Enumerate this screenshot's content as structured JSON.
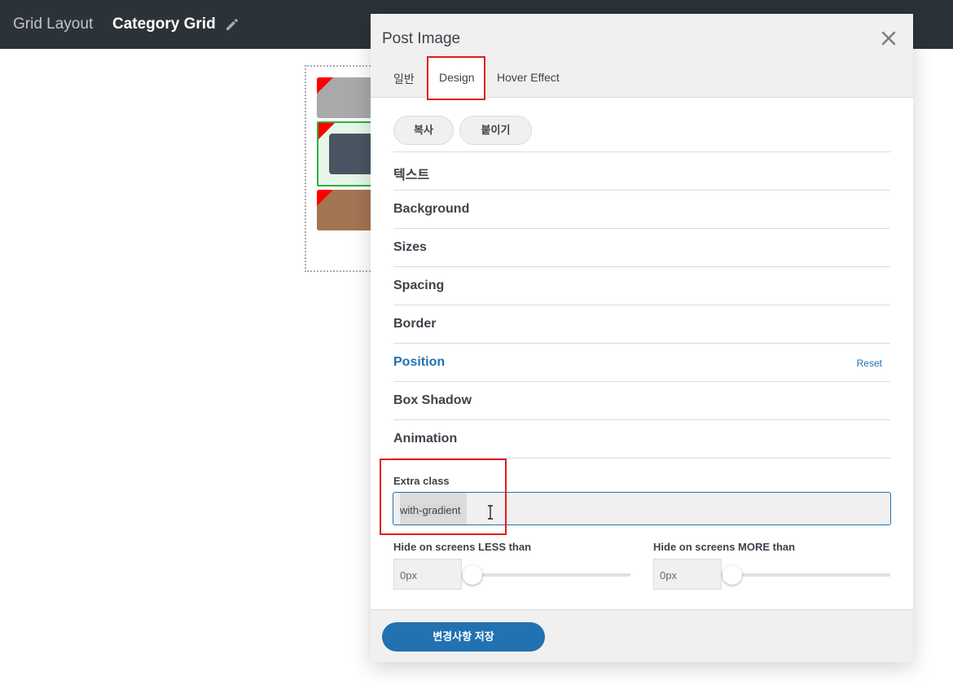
{
  "topbar": {
    "breadcrumb": "Grid Layout",
    "title": "Category Grid",
    "edit_icon": "pencil-icon"
  },
  "modal": {
    "title": "Post Image",
    "close_icon": "close-icon",
    "tabs": [
      {
        "label": "일반"
      },
      {
        "label": "Design",
        "active": true
      },
      {
        "label": "Hover Effect"
      }
    ],
    "copy_label": "복사",
    "paste_label": "붙이기",
    "sections": [
      {
        "label": "텍스트"
      },
      {
        "label": "Background"
      },
      {
        "label": "Sizes"
      },
      {
        "label": "Spacing"
      },
      {
        "label": "Border"
      },
      {
        "label": "Position",
        "active": true,
        "reset_label": "Reset"
      },
      {
        "label": "Box Shadow"
      },
      {
        "label": "Animation"
      }
    ],
    "extra_class": {
      "label": "Extra class",
      "value": "with-gradient"
    },
    "hide_less": {
      "label": "Hide on screens LESS than",
      "value": "0px"
    },
    "hide_more": {
      "label": "Hide on screens MORE than",
      "value": "0px"
    },
    "save_label": "변경사항 저장"
  },
  "colors": {
    "accent": "#2271b1",
    "highlight_box": "#e31c1c",
    "topbar": "#2c3338"
  }
}
